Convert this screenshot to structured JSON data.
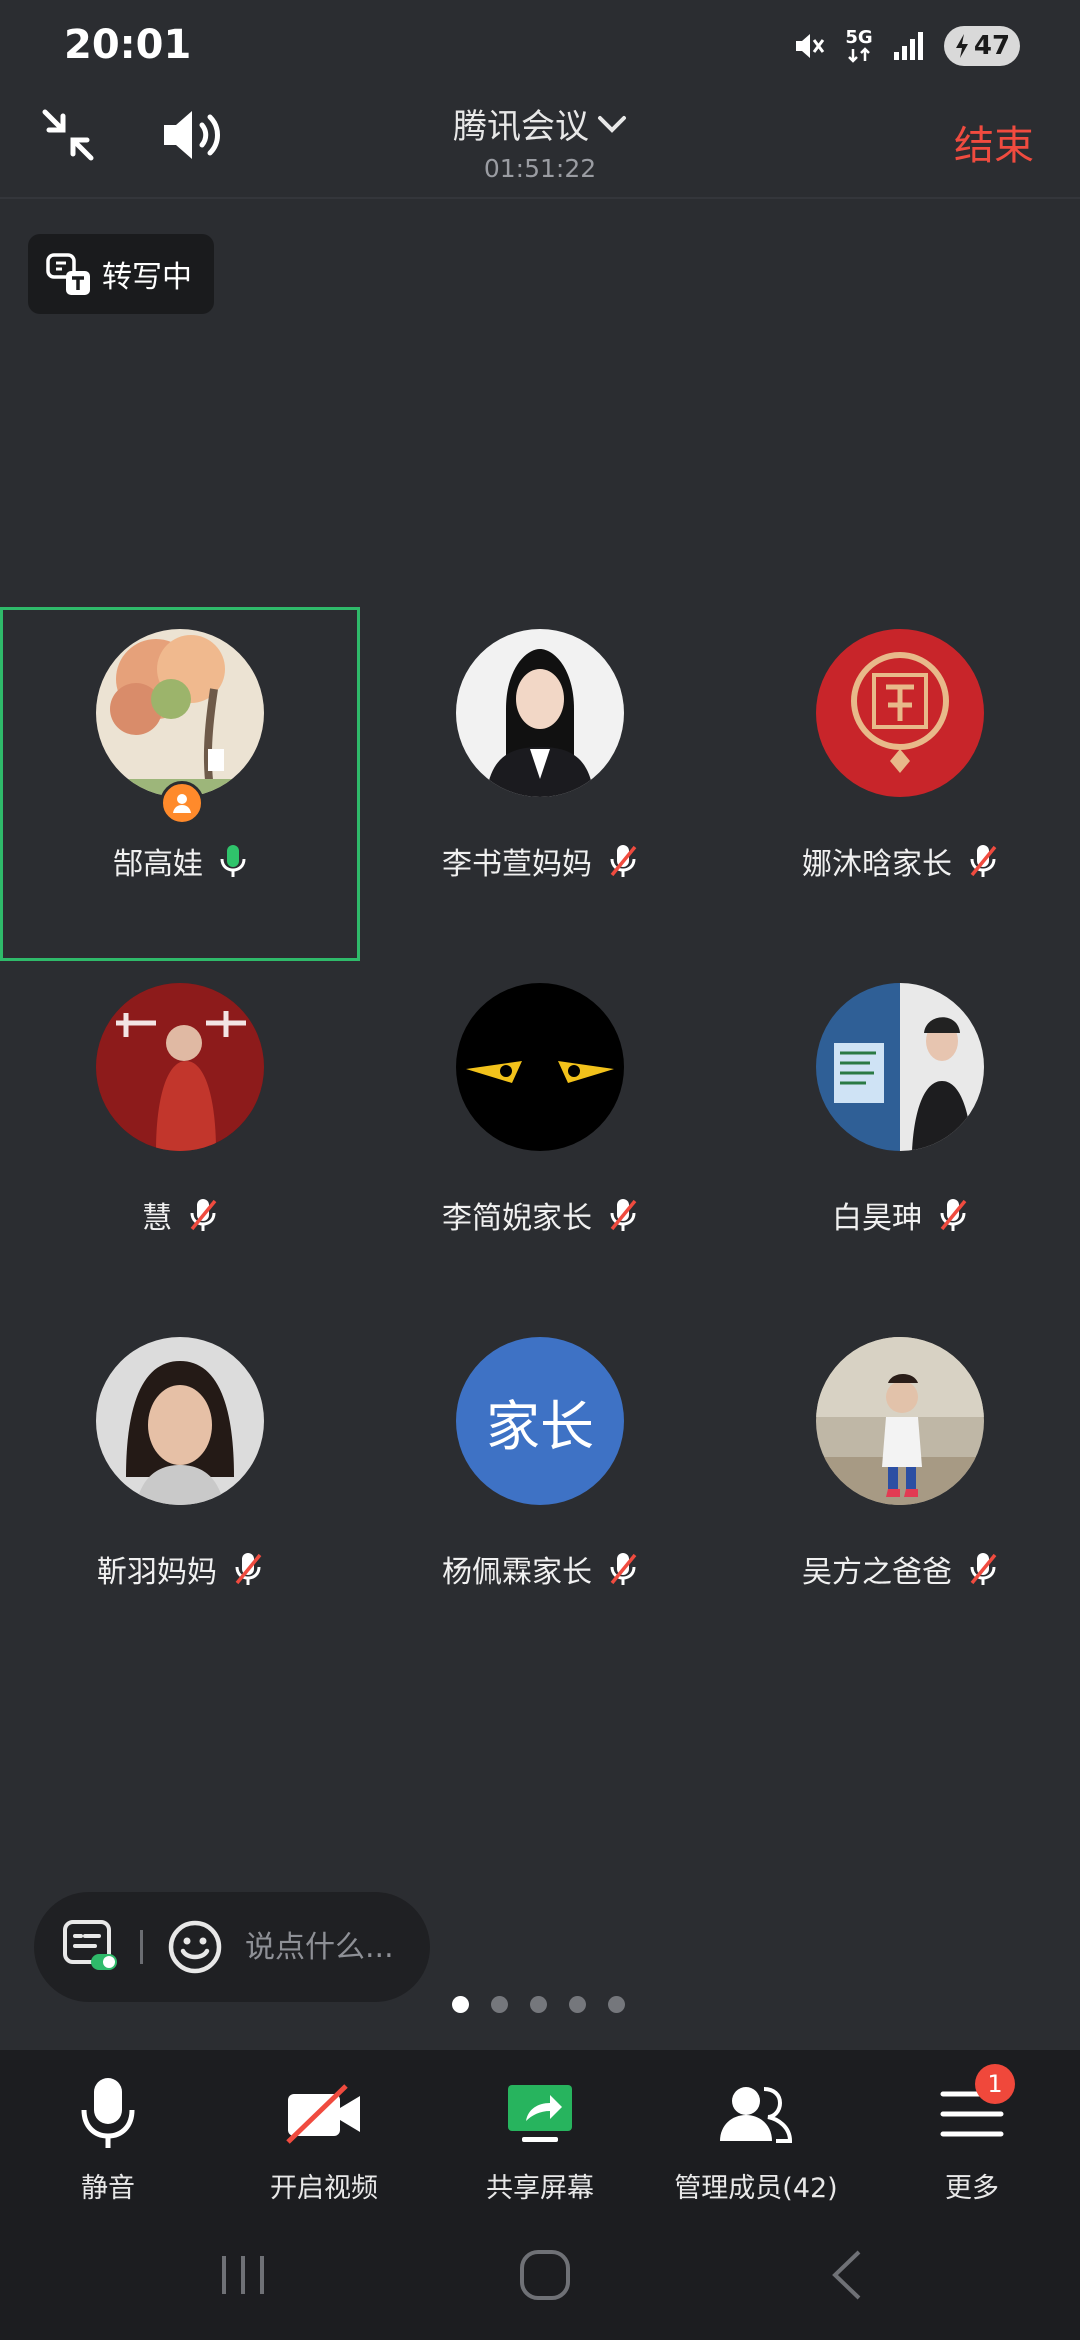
{
  "status_bar": {
    "time": "20:01",
    "network": "5G",
    "battery": "47"
  },
  "header": {
    "title": "腾讯会议",
    "timer": "01:51:22",
    "end_label": "结束"
  },
  "transcribe": {
    "label": "转写中"
  },
  "participants": [
    {
      "name": "郜高娃",
      "mic": "on",
      "host": true
    },
    {
      "name": "李书萱妈妈",
      "mic": "muted"
    },
    {
      "name": "娜沐晗家长",
      "mic": "muted"
    },
    {
      "name": "慧",
      "mic": "muted"
    },
    {
      "name": "李简婗家长",
      "mic": "muted"
    },
    {
      "name": "白昊珅",
      "mic": "muted"
    },
    {
      "name": "靳羽妈妈",
      "mic": "muted"
    },
    {
      "name": "杨佩霖家长",
      "mic": "muted",
      "avatar_text": "家长"
    },
    {
      "name": "吴方之爸爸",
      "mic": "muted"
    }
  ],
  "chat": {
    "placeholder": "说点什么..."
  },
  "pager": {
    "pages": 5,
    "current": 1
  },
  "toolbar": {
    "mute_label": "静音",
    "video_label": "开启视频",
    "share_label": "共享屏幕",
    "members_label": "管理成员(42)",
    "more_label": "更多",
    "more_badge": "1"
  },
  "colors": {
    "background": "#2b2d31",
    "toolbar": "#1c1d20",
    "end_red": "#f04b3f",
    "active_border": "#2fba6a",
    "share_green": "#27b45e"
  }
}
